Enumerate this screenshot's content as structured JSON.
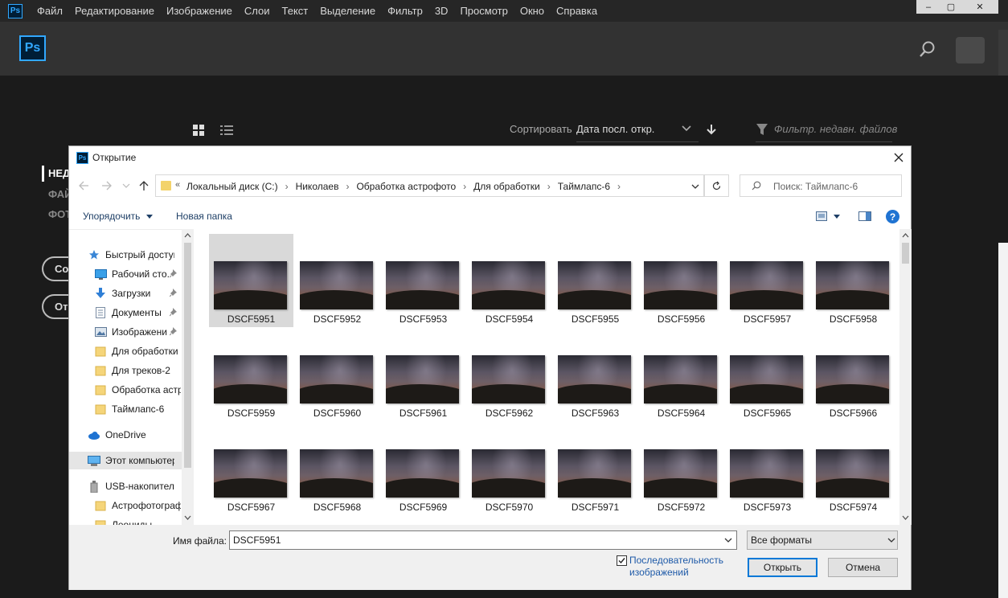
{
  "app": {
    "mini_logo": "Ps",
    "logo": "Ps",
    "menu": [
      "Файл",
      "Редактирование",
      "Изображение",
      "Слои",
      "Текст",
      "Выделение",
      "Фильтр",
      "3D",
      "Просмотр",
      "Окно",
      "Справка"
    ],
    "window_controls": [
      "‒",
      "▢",
      "✕"
    ],
    "sort_label": "Сортировать",
    "sort_value": "Дата посл. откр.",
    "filter_placeholder": "Фильтр. недавн. файлов",
    "left_nav": [
      "НЕД",
      "ФАЙ",
      "ФОТ"
    ],
    "pill_buttons": [
      "Со",
      "От"
    ]
  },
  "dialog": {
    "icon": "Ps",
    "title": "Открытие",
    "breadcrumb_prefix": "«",
    "breadcrumbs": [
      "Локальный диск (C:)",
      "Николаев",
      "Обработка астрофото",
      "Для обработки",
      "Таймлапс-6"
    ],
    "search_placeholder": "Поиск: Таймлапс-6",
    "organize_label": "Упорядочить",
    "new_folder_label": "Новая папка",
    "help": "?",
    "nav_items": [
      {
        "label": "Быстрый доступ",
        "icon": "star-icon",
        "pinned": false
      },
      {
        "label": "Рабочий сто.",
        "icon": "desktop-icon",
        "pinned": true
      },
      {
        "label": "Загрузки",
        "icon": "download-icon",
        "pinned": true
      },
      {
        "label": "Документы",
        "icon": "document-icon",
        "pinned": true
      },
      {
        "label": "Изображени",
        "icon": "pictures-icon",
        "pinned": true
      },
      {
        "label": "Для обработки",
        "icon": "folder-icon",
        "pinned": false
      },
      {
        "label": "Для треков-2",
        "icon": "folder-icon",
        "pinned": false
      },
      {
        "label": "Обработка астр",
        "icon": "folder-icon",
        "pinned": false
      },
      {
        "label": "Таймлапс-6",
        "icon": "folder-icon",
        "pinned": false
      },
      {
        "label": "OneDrive",
        "icon": "cloud-icon",
        "pinned": false
      },
      {
        "label": "Этот компьютер",
        "icon": "computer-icon",
        "pinned": false
      },
      {
        "label": "USB-накопитель",
        "icon": "usb-drive-icon",
        "pinned": false
      },
      {
        "label": "Астрофотограф",
        "icon": "folder-icon",
        "pinned": false
      },
      {
        "label": "Леониды",
        "icon": "folder-icon",
        "pinned": false
      }
    ],
    "files": [
      "DSCF5951",
      "DSCF5952",
      "DSCF5953",
      "DSCF5954",
      "DSCF5955",
      "DSCF5956",
      "DSCF5957",
      "DSCF5958",
      "DSCF5959",
      "DSCF5960",
      "DSCF5961",
      "DSCF5962",
      "DSCF5963",
      "DSCF5964",
      "DSCF5965",
      "DSCF5966",
      "DSCF5967",
      "DSCF5968",
      "DSCF5969",
      "DSCF5970",
      "DSCF5971",
      "DSCF5972",
      "DSCF5973",
      "DSCF5974"
    ],
    "selected_file": "DSCF5951",
    "filename_label": "Имя файла:",
    "filename_value": "DSCF5951",
    "format_value": "Все форматы",
    "sequence_label": "Последовательность изображений",
    "sequence_checked": true,
    "open_label": "Открыть",
    "cancel_label": "Отмена"
  }
}
